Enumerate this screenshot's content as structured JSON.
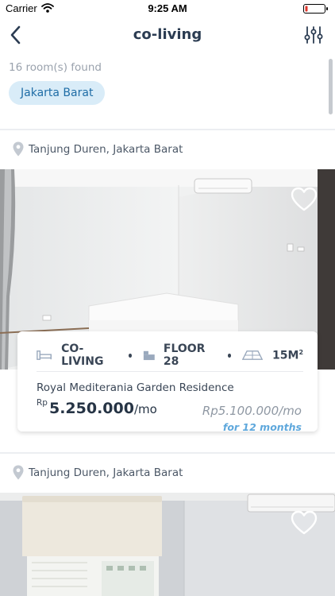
{
  "status_bar": {
    "carrier": "Carrier",
    "time": "9:25 AM"
  },
  "navbar": {
    "title": "co-living"
  },
  "summary": {
    "count_text": "16 room(s) found",
    "chip_label": "Jakarta Barat"
  },
  "listings": [
    {
      "location": "Tanjung Duren, Jakarta Barat",
      "type": "CO-LIVING",
      "floor": "FLOOR 28",
      "size": "15M",
      "size_sup": "2",
      "name": "Royal Mediterania Garden Residence",
      "currency": "Rp",
      "price": "5.250.000",
      "per": "/mo",
      "alt_price": "Rp5.100.000/mo",
      "alt_note": "for 12 months",
      "favorited": false
    },
    {
      "location": "Tanjung Duren, Jakarta Barat",
      "favorited": false
    }
  ],
  "colors": {
    "accent": "#5fa8dc",
    "chip_bg": "#d9ecf8",
    "chip_text": "#1f6da6",
    "nav_title": "#2b3c52"
  },
  "icons": {
    "back": "chevron-left-icon",
    "filter": "sliders-icon",
    "location": "map-pin-icon",
    "favorite": "heart-outline-icon",
    "type": "bed-icon",
    "floor": "building-icon",
    "size": "floor-area-icon"
  }
}
